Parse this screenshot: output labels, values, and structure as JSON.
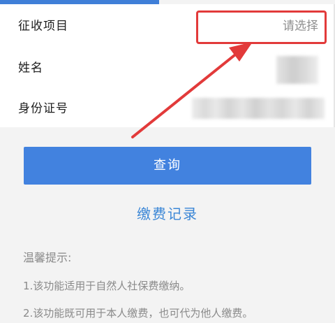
{
  "form": {
    "rows": [
      {
        "label": "征收项目",
        "value": "请选择"
      },
      {
        "label": "姓名",
        "value": ""
      },
      {
        "label": "身份证号",
        "value": ""
      }
    ]
  },
  "actions": {
    "query_label": "查询",
    "records_label": "缴费记录"
  },
  "tips": {
    "title": "温馨提示:",
    "items": [
      "1.该功能适用于自然人社保费缴纳。",
      "2.该功能既可用于本人缴费，也可代为他人缴费。"
    ]
  },
  "colors": {
    "primary_button": "#4282df",
    "link": "#3a86d6",
    "annotation": "#e23a3a"
  }
}
